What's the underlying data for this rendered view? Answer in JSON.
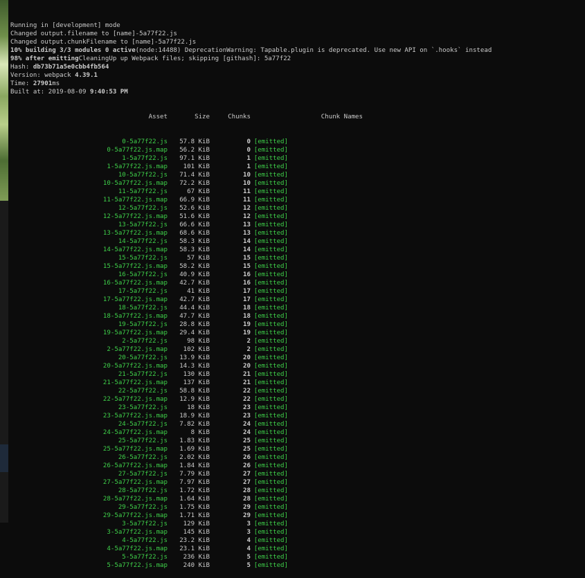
{
  "terminal": {
    "intro": [
      {
        "text": "Running in [development] mode"
      },
      {
        "text": "Changed output.filename to [name]-5a77f22.js"
      },
      {
        "text": "Changed output.chunkFilename to [name]-5a77f22.js"
      },
      {
        "bold": "10% building 3/3 modules 0 active",
        "text": "(node:14488) DeprecationWarning: Tapable.plugin is deprecated. Use new API on `.hooks` instead"
      },
      {
        "bold": "98% after emitting",
        "text": "CleaningUp up Webpack files; skipping [githash]: 5a77f22"
      },
      {
        "label": "Hash: ",
        "bold": "db73b71a5e0cbb4fb564"
      },
      {
        "label": "Version: webpack ",
        "bold": "4.39.1"
      },
      {
        "label": "Time: ",
        "bold": "27901",
        "text": "ms"
      },
      {
        "label": "Built at: 2019-08-09 ",
        "bold": "9:40:53 PM"
      }
    ],
    "columns": {
      "asset": "Asset",
      "size": "Size",
      "chunks": "Chunks",
      "status": "",
      "names": "Chunk Names"
    },
    "assets": [
      {
        "asset": "0-5a77f22.js",
        "size": "57.8 KiB",
        "chunk": "0",
        "status": "[emitted]"
      },
      {
        "asset": "0-5a77f22.js.map",
        "size": "56.2 KiB",
        "chunk": "0",
        "status": "[emitted]"
      },
      {
        "asset": "1-5a77f22.js",
        "size": "97.1 KiB",
        "chunk": "1",
        "status": "[emitted]"
      },
      {
        "asset": "1-5a77f22.js.map",
        "size": "101 KiB",
        "chunk": "1",
        "status": "[emitted]"
      },
      {
        "asset": "10-5a77f22.js",
        "size": "71.4 KiB",
        "chunk": "10",
        "status": "[emitted]"
      },
      {
        "asset": "10-5a77f22.js.map",
        "size": "72.2 KiB",
        "chunk": "10",
        "status": "[emitted]"
      },
      {
        "asset": "11-5a77f22.js",
        "size": "67 KiB",
        "chunk": "11",
        "status": "[emitted]"
      },
      {
        "asset": "11-5a77f22.js.map",
        "size": "66.9 KiB",
        "chunk": "11",
        "status": "[emitted]"
      },
      {
        "asset": "12-5a77f22.js",
        "size": "52.6 KiB",
        "chunk": "12",
        "status": "[emitted]"
      },
      {
        "asset": "12-5a77f22.js.map",
        "size": "51.6 KiB",
        "chunk": "12",
        "status": "[emitted]"
      },
      {
        "asset": "13-5a77f22.js",
        "size": "66.6 KiB",
        "chunk": "13",
        "status": "[emitted]"
      },
      {
        "asset": "13-5a77f22.js.map",
        "size": "68.6 KiB",
        "chunk": "13",
        "status": "[emitted]"
      },
      {
        "asset": "14-5a77f22.js",
        "size": "58.3 KiB",
        "chunk": "14",
        "status": "[emitted]"
      },
      {
        "asset": "14-5a77f22.js.map",
        "size": "58.3 KiB",
        "chunk": "14",
        "status": "[emitted]"
      },
      {
        "asset": "15-5a77f22.js",
        "size": "57 KiB",
        "chunk": "15",
        "status": "[emitted]"
      },
      {
        "asset": "15-5a77f22.js.map",
        "size": "58.2 KiB",
        "chunk": "15",
        "status": "[emitted]"
      },
      {
        "asset": "16-5a77f22.js",
        "size": "40.9 KiB",
        "chunk": "16",
        "status": "[emitted]"
      },
      {
        "asset": "16-5a77f22.js.map",
        "size": "42.7 KiB",
        "chunk": "16",
        "status": "[emitted]"
      },
      {
        "asset": "17-5a77f22.js",
        "size": "41 KiB",
        "chunk": "17",
        "status": "[emitted]"
      },
      {
        "asset": "17-5a77f22.js.map",
        "size": "42.7 KiB",
        "chunk": "17",
        "status": "[emitted]"
      },
      {
        "asset": "18-5a77f22.js",
        "size": "44.4 KiB",
        "chunk": "18",
        "status": "[emitted]"
      },
      {
        "asset": "18-5a77f22.js.map",
        "size": "47.7 KiB",
        "chunk": "18",
        "status": "[emitted]"
      },
      {
        "asset": "19-5a77f22.js",
        "size": "28.8 KiB",
        "chunk": "19",
        "status": "[emitted]"
      },
      {
        "asset": "19-5a77f22.js.map",
        "size": "29.4 KiB",
        "chunk": "19",
        "status": "[emitted]"
      },
      {
        "asset": "2-5a77f22.js",
        "size": "98 KiB",
        "chunk": "2",
        "status": "[emitted]"
      },
      {
        "asset": "2-5a77f22.js.map",
        "size": "102 KiB",
        "chunk": "2",
        "status": "[emitted]"
      },
      {
        "asset": "20-5a77f22.js",
        "size": "13.9 KiB",
        "chunk": "20",
        "status": "[emitted]"
      },
      {
        "asset": "20-5a77f22.js.map",
        "size": "14.3 KiB",
        "chunk": "20",
        "status": "[emitted]"
      },
      {
        "asset": "21-5a77f22.js",
        "size": "130 KiB",
        "chunk": "21",
        "status": "[emitted]"
      },
      {
        "asset": "21-5a77f22.js.map",
        "size": "137 KiB",
        "chunk": "21",
        "status": "[emitted]"
      },
      {
        "asset": "22-5a77f22.js",
        "size": "58.8 KiB",
        "chunk": "22",
        "status": "[emitted]"
      },
      {
        "asset": "22-5a77f22.js.map",
        "size": "12.9 KiB",
        "chunk": "22",
        "status": "[emitted]"
      },
      {
        "asset": "23-5a77f22.js",
        "size": "18 KiB",
        "chunk": "23",
        "status": "[emitted]"
      },
      {
        "asset": "23-5a77f22.js.map",
        "size": "18.9 KiB",
        "chunk": "23",
        "status": "[emitted]"
      },
      {
        "asset": "24-5a77f22.js",
        "size": "7.82 KiB",
        "chunk": "24",
        "status": "[emitted]"
      },
      {
        "asset": "24-5a77f22.js.map",
        "size": "8 KiB",
        "chunk": "24",
        "status": "[emitted]"
      },
      {
        "asset": "25-5a77f22.js",
        "size": "1.83 KiB",
        "chunk": "25",
        "status": "[emitted]"
      },
      {
        "asset": "25-5a77f22.js.map",
        "size": "1.69 KiB",
        "chunk": "25",
        "status": "[emitted]"
      },
      {
        "asset": "26-5a77f22.js",
        "size": "2.02 KiB",
        "chunk": "26",
        "status": "[emitted]"
      },
      {
        "asset": "26-5a77f22.js.map",
        "size": "1.84 KiB",
        "chunk": "26",
        "status": "[emitted]"
      },
      {
        "asset": "27-5a77f22.js",
        "size": "7.79 KiB",
        "chunk": "27",
        "status": "[emitted]"
      },
      {
        "asset": "27-5a77f22.js.map",
        "size": "7.97 KiB",
        "chunk": "27",
        "status": "[emitted]"
      },
      {
        "asset": "28-5a77f22.js",
        "size": "1.72 KiB",
        "chunk": "28",
        "status": "[emitted]"
      },
      {
        "asset": "28-5a77f22.js.map",
        "size": "1.64 KiB",
        "chunk": "28",
        "status": "[emitted]"
      },
      {
        "asset": "29-5a77f22.js",
        "size": "1.75 KiB",
        "chunk": "29",
        "status": "[emitted]"
      },
      {
        "asset": "29-5a77f22.js.map",
        "size": "1.71 KiB",
        "chunk": "29",
        "status": "[emitted]"
      },
      {
        "asset": "3-5a77f22.js",
        "size": "129 KiB",
        "chunk": "3",
        "status": "[emitted]"
      },
      {
        "asset": "3-5a77f22.js.map",
        "size": "145 KiB",
        "chunk": "3",
        "status": "[emitted]"
      },
      {
        "asset": "4-5a77f22.js",
        "size": "23.2 KiB",
        "chunk": "4",
        "status": "[emitted]"
      },
      {
        "asset": "4-5a77f22.js.map",
        "size": "23.1 KiB",
        "chunk": "4",
        "status": "[emitted]"
      },
      {
        "asset": "5-5a77f22.js",
        "size": "236 KiB",
        "chunk": "5",
        "status": "[emitted]"
      },
      {
        "asset": "5-5a77f22.js.map",
        "size": "240 KiB",
        "chunk": "5",
        "status": "[emitted]"
      }
    ]
  },
  "colors": {
    "background": "#0c0c0c",
    "text": "#cccccc",
    "asset_green": "#3fd14a"
  }
}
